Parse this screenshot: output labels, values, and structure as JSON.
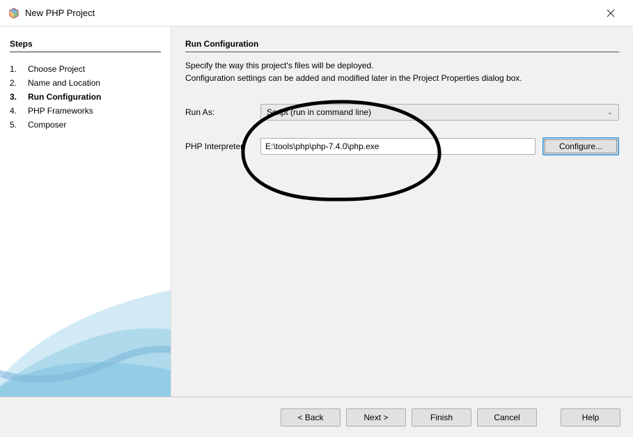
{
  "window": {
    "title": "New PHP Project"
  },
  "sidebar": {
    "heading": "Steps",
    "items": [
      {
        "num": "1.",
        "label": "Choose Project"
      },
      {
        "num": "2.",
        "label": "Name and Location"
      },
      {
        "num": "3.",
        "label": "Run Configuration",
        "current": true
      },
      {
        "num": "4.",
        "label": "PHP Frameworks"
      },
      {
        "num": "5.",
        "label": "Composer"
      }
    ]
  },
  "content": {
    "heading": "Run Configuration",
    "desc1": "Specify the way this project's files will be deployed.",
    "desc2": "Configuration settings can be added and modified later in the Project Properties dialog box.",
    "runAsLabel": "Run As:",
    "runAsValue": "Script (run in command line)",
    "interpreterLabel": "PHP Interpreter:",
    "interpreterValue": "E:\\tools\\php\\php-7.4.0\\php.exe",
    "configureLabel": "Configure..."
  },
  "buttons": {
    "back": "< Back",
    "next": "Next >",
    "finish": "Finish",
    "cancel": "Cancel",
    "help": "Help"
  }
}
